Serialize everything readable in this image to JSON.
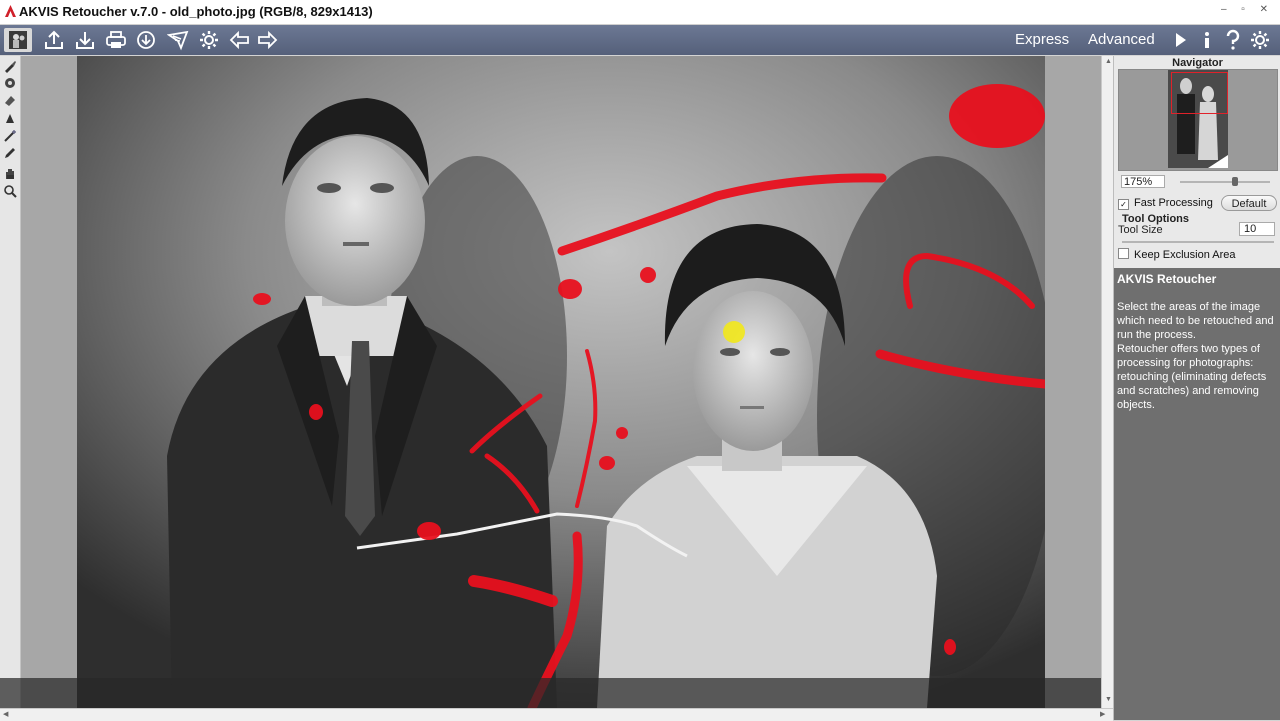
{
  "window": {
    "title": "AKVIS Retoucher v.7.0 - old_photo.jpg (RGB/8, 829x1413)",
    "controls": "– ▫ ✕"
  },
  "toolbar": {
    "buttons": [
      {
        "icon": "photo-before-after-icon"
      },
      {
        "icon": "open-icon"
      },
      {
        "icon": "save-icon"
      },
      {
        "icon": "print-icon"
      },
      {
        "icon": "share-icon"
      },
      {
        "icon": "run-processing-icon"
      },
      {
        "icon": "presets-gear-icon"
      },
      {
        "icon": "undo-arrow-icon"
      },
      {
        "icon": "redo-arrow-icon"
      }
    ],
    "mode_express": "Express",
    "mode_advanced": "Advanced",
    "right_icons": [
      "play-icon",
      "info-icon",
      "help-icon",
      "settings-icon"
    ]
  },
  "tools": [
    "brush-icon",
    "stamp-icon",
    "eraser-icon",
    "fill-icon",
    "magic-wand-icon",
    "pencil-icon",
    "hand-icon",
    "zoom-icon"
  ],
  "navigator": {
    "title": "Navigator",
    "zoom": "175%"
  },
  "options": {
    "fast_processing_label": "Fast Processing",
    "fast_processing_checked": true,
    "default_button": "Default",
    "tool_options_title": "Tool Options",
    "tool_size_label": "Tool Size",
    "tool_size_value": "10",
    "keep_exclusion_label": "Keep Exclusion Area",
    "keep_exclusion_checked": false
  },
  "help": {
    "title": "AKVIS Retoucher",
    "text1": "Select the areas of the image which need to be retouched and run the process.",
    "text2": "Retoucher offers two types of processing for photographs: retouching (eliminating defects and scratches) and removing objects."
  },
  "colors": {
    "toolbar": "#5d6883",
    "mark_red": "#e8101e",
    "cursor_yellow": "#f2e81a",
    "help_bg": "#6f6f6f"
  }
}
